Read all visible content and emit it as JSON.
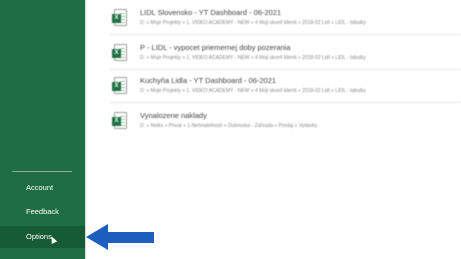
{
  "sidebar": {
    "items": [
      {
        "label": "Account"
      },
      {
        "label": "Feedback"
      },
      {
        "label": "Options"
      }
    ]
  },
  "recent_files": [
    {
      "title": "LIDL Slovensko - YT Dashboard - 06-2021",
      "path": "D: » Moje Projekty » 1. VIDEO ACADEMY - NEW » 4 Moji skvelí klienti » 2018-02 Lidl » LIDL - tabulky"
    },
    {
      "title": "P - LIDL - vypocet priemernej doby pozerania",
      "path": "D: » Moje Projekty » 1. VIDEO ACADEMY - NEW » 4 Moji skvelí klienti » 2018-02 Lidl » LIDL - tabulky"
    },
    {
      "title": "Kuchyňa Lidla - YT Dashboard - 06-2021",
      "path": "D: » Moje Projekty » 1. VIDEO ACADEMY - NEW » 4 Moji skvelí klienti » 2018-02 Lidl » LIDL - tabulky"
    },
    {
      "title": "Vynalozene naklady",
      "path": "D: » Neiko » Privat » 1-Nehnutelnosti » Dubovska - Zahrada » Predaj » Vydavky"
    }
  ],
  "icons": {
    "file": "excel-file-icon",
    "pointer": "arrow-pointer-icon",
    "cursor": "mouse-cursor-icon"
  },
  "colors": {
    "sidebar": "#1f6e43",
    "sidebar_active": "#175a36",
    "arrow": "#1d5fbf"
  }
}
